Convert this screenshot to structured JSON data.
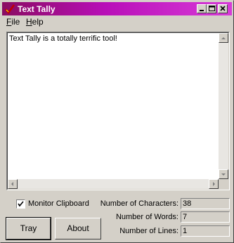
{
  "window": {
    "title": "Text Tally",
    "titlebar_color_start": "#8a0c62",
    "titlebar_color_end": "#d83bd8"
  },
  "menu": {
    "file": "File",
    "help": "Help"
  },
  "editor": {
    "text": "Text Tally is a totally terrific tool!"
  },
  "monitor": {
    "label": "Monitor Clipboard",
    "checked": true
  },
  "buttons": {
    "tray": "Tray",
    "about": "About"
  },
  "stats": {
    "characters_label": "Number of Characters:",
    "characters_value": "38",
    "words_label": "Number of Words:",
    "words_value": "7",
    "lines_label": "Number of Lines:",
    "lines_value": "1"
  }
}
